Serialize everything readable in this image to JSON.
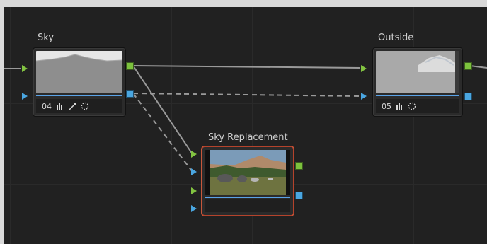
{
  "nodes": {
    "sky": {
      "title": "Sky",
      "number": "04",
      "icons": [
        "levels-icon",
        "eyedropper-icon",
        "circle-window-icon"
      ]
    },
    "outside": {
      "title": "Outside",
      "number": "05",
      "icons": [
        "levels-icon",
        "circle-window-icon"
      ]
    },
    "sky_replacement": {
      "title": "Sky Replacement"
    }
  },
  "colors": {
    "canvas": "#212121",
    "rgb_link": "#9a9a9a",
    "alpha_link": "#9a9a9a",
    "rgb_port": "#7cc23d",
    "alpha_port": "#4aa6e0",
    "selected_outline": "#c8573b"
  }
}
